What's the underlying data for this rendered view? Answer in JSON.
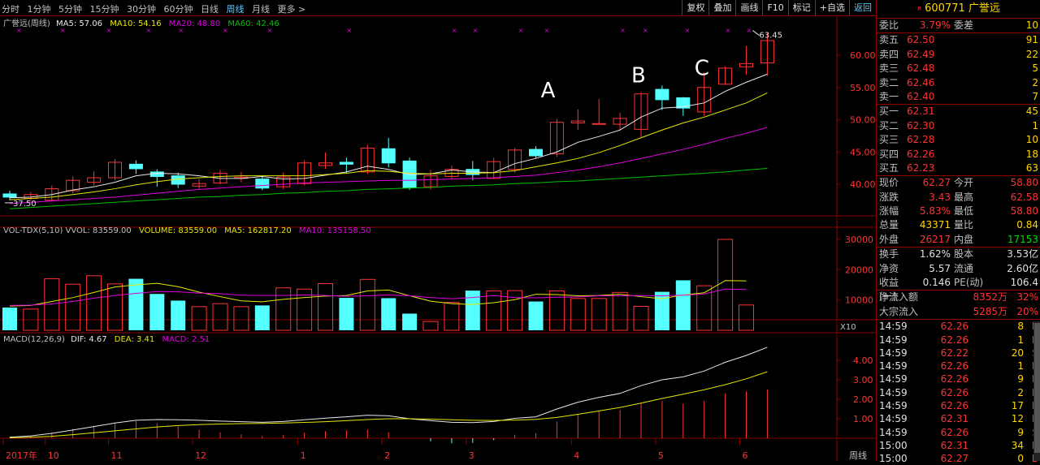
{
  "toolbar": {
    "periods": [
      "分时",
      "1分钟",
      "5分钟",
      "15分钟",
      "30分钟",
      "60分钟",
      "日线",
      "周线",
      "月线",
      "更多 >"
    ],
    "active_period": "周线",
    "buttons": [
      "复权",
      "叠加",
      "画线",
      "F10",
      "标记",
      "+自选",
      "返回"
    ]
  },
  "main_header": {
    "name": "广誉远(周线)",
    "ma5": "MA5: 57.06",
    "ma10": "MA10: 54.16",
    "ma20": "MA20: 48.80",
    "ma60": "MA60: 42.46"
  },
  "vol_header": {
    "name": "VOL-TDX(5,10) VVOL: 83559.00",
    "volume": "VOLUME: 83559.00",
    "ma5": "MA5: 162817.20",
    "ma10": "MA10: 135158.50"
  },
  "macd_header": {
    "name": "MACD(12,26,9)",
    "dif": "DIF: 4.67",
    "dea": "DEA: 3.41",
    "macd": "MACD: 2.51"
  },
  "colors": {
    "up": "#ff3333",
    "down": "#54ffff",
    "ma5": "#e8e8e8",
    "ma10": "#e6e600",
    "ma20": "#e000e0",
    "ma60": "#00c000",
    "grid": "#8b0000"
  },
  "chart_data": {
    "type": "candlestick",
    "price_axis": [
      "60.00",
      "55.00",
      "50.00",
      "45.00",
      "40.00"
    ],
    "vol_axis": [
      "30000",
      "20000",
      "10000"
    ],
    "vol_unit": "X10",
    "macd_axis": [
      "4.00",
      "3.00",
      "2.00",
      "1.00"
    ],
    "x_labels": [
      {
        "i": 0,
        "t": "2017年"
      },
      {
        "i": 2,
        "t": "10"
      },
      {
        "i": 5,
        "t": "11"
      },
      {
        "i": 9,
        "t": "12"
      },
      {
        "i": 14,
        "t": "1"
      },
      {
        "i": 18,
        "t": "2"
      },
      {
        "i": 22,
        "t": "3"
      },
      {
        "i": 27,
        "t": "4"
      },
      {
        "i": 31,
        "t": "5"
      },
      {
        "i": 35,
        "t": "6"
      }
    ],
    "axis_corner": "周线",
    "high_label": "63.45",
    "low_label": "37.50",
    "annotations": [
      {
        "i": 25.7,
        "t": "A"
      },
      {
        "i": 30,
        "t": "B"
      },
      {
        "i": 33,
        "t": "C"
      }
    ],
    "candles": [
      [
        38.5,
        38.0,
        39.0,
        37.5
      ],
      [
        37.8,
        38.4,
        38.8,
        37.4
      ],
      [
        37.5,
        39.3,
        39.8,
        37.3
      ],
      [
        39.0,
        40.6,
        41.2,
        38.6
      ],
      [
        40.3,
        41.0,
        42.0,
        39.8
      ],
      [
        41.0,
        43.4,
        43.9,
        40.6
      ],
      [
        43.1,
        42.4,
        43.7,
        41.6
      ],
      [
        41.9,
        41.2,
        42.3,
        39.6
      ],
      [
        41.3,
        40.0,
        41.8,
        39.4
      ],
      [
        39.7,
        40.1,
        40.8,
        39.3
      ],
      [
        40.2,
        41.7,
        42.2,
        40.0
      ],
      [
        40.9,
        41.1,
        41.9,
        40.3
      ],
      [
        40.8,
        39.4,
        41.2,
        39.1
      ],
      [
        39.6,
        41.1,
        41.8,
        39.2
      ],
      [
        40.1,
        43.3,
        43.7,
        39.8
      ],
      [
        42.9,
        43.3,
        44.9,
        42.4
      ],
      [
        43.4,
        43.1,
        44.1,
        41.7
      ],
      [
        41.9,
        45.6,
        46.1,
        41.6
      ],
      [
        45.5,
        43.3,
        47.2,
        42.6
      ],
      [
        43.6,
        39.5,
        44.1,
        39.1
      ],
      [
        39.6,
        41.3,
        42.2,
        39.2
      ],
      [
        41.2,
        42.3,
        42.9,
        40.7
      ],
      [
        42.3,
        41.5,
        43.6,
        40.6
      ],
      [
        40.9,
        43.5,
        44.1,
        40.8
      ],
      [
        42.3,
        45.3,
        45.6,
        41.8
      ],
      [
        45.4,
        44.4,
        45.9,
        44.0
      ],
      [
        44.7,
        49.6,
        50.1,
        44.2
      ],
      [
        49.5,
        49.8,
        51.6,
        48.4
      ],
      [
        49.4,
        49.4,
        53.2,
        49.4
      ],
      [
        49.3,
        50.2,
        51.1,
        48.4
      ],
      [
        48.5,
        54.0,
        54.3,
        47.3
      ],
      [
        54.7,
        53.1,
        55.3,
        51.5
      ],
      [
        53.4,
        51.8,
        53.5,
        50.6
      ],
      [
        51.2,
        55.0,
        57.3,
        50.6
      ],
      [
        55.5,
        58.0,
        58.3,
        55.4
      ],
      [
        58.2,
        58.7,
        61.4,
        57.0
      ],
      [
        58.8,
        62.27,
        63.45,
        56.8
      ]
    ],
    "volumes": [
      7500,
      7000,
      17000,
      15200,
      18000,
      15300,
      17000,
      12000,
      9800,
      7800,
      8800,
      7800,
      8200,
      14000,
      13600,
      15400,
      10700,
      16800,
      10600,
      5500,
      2900,
      9200,
      13100,
      13000,
      13100,
      9500,
      13000,
      10500,
      10500,
      12500,
      7900,
      12700,
      16500,
      14700,
      30000,
      8356
    ],
    "ma5": [
      37.9,
      38.0,
      38.4,
      39.1,
      39.6,
      40.3,
      41.3,
      41.7,
      41.6,
      41.3,
      40.9,
      40.9,
      41.2,
      40.8,
      40.9,
      41.4,
      41.9,
      42.8,
      42.3,
      41.5,
      41.6,
      42.2,
      41.9,
      41.8,
      43.2,
      44.0,
      45.0,
      46.5,
      47.4,
      48.4,
      50.4,
      51.8,
      52.0,
      52.6,
      54.4,
      55.8,
      57.06
    ],
    "ma10": [
      37.6,
      37.8,
      38.0,
      38.4,
      38.8,
      39.3,
      39.9,
      40.4,
      40.8,
      41.0,
      41.2,
      41.3,
      41.3,
      41.3,
      41.3,
      41.5,
      41.7,
      42.1,
      42.0,
      41.7,
      41.6,
      41.7,
      41.7,
      41.8,
      42.1,
      42.7,
      43.3,
      44.0,
      44.9,
      46.0,
      47.2,
      48.4,
      49.5,
      50.4,
      51.5,
      52.6,
      54.16
    ],
    "ma20": [
      37.0,
      37.2,
      37.4,
      37.6,
      37.8,
      38.0,
      38.3,
      38.6,
      38.9,
      39.2,
      39.4,
      39.6,
      39.8,
      40.0,
      40.2,
      40.3,
      40.4,
      40.5,
      40.6,
      40.6,
      40.7,
      40.8,
      40.9,
      41.0,
      41.2,
      41.4,
      41.8,
      42.2,
      42.7,
      43.3,
      44.0,
      44.7,
      45.4,
      46.2,
      47.1,
      47.9,
      48.8
    ],
    "ma60": [
      36.2,
      36.4,
      36.6,
      36.8,
      37.0,
      37.2,
      37.4,
      37.6,
      37.8,
      38.0,
      38.1,
      38.3,
      38.4,
      38.6,
      38.7,
      38.9,
      39.0,
      39.2,
      39.3,
      39.4,
      39.5,
      39.7,
      39.8,
      39.9,
      40.1,
      40.2,
      40.4,
      40.5,
      40.7,
      40.9,
      41.1,
      41.3,
      41.5,
      41.7,
      41.9,
      42.2,
      42.46
    ],
    "vol_ma5": [
      8000,
      8200,
      9500,
      10800,
      12500,
      14300,
      15000,
      15500,
      14400,
      12600,
      11100,
      9700,
      9400,
      10200,
      10800,
      11300,
      11500,
      13000,
      13300,
      11400,
      9600,
      8800,
      8500,
      9100,
      10100,
      11900,
      11800,
      11400,
      11500,
      11900,
      11100,
      10400,
      11700,
      12400,
      16400,
      16300
    ],
    "vol_ma10": [
      8200,
      8300,
      8700,
      9500,
      10600,
      11500,
      12200,
      12800,
      12700,
      12300,
      12100,
      11600,
      11500,
      11500,
      11700,
      11500,
      11200,
      11400,
      11700,
      11400,
      10800,
      10400,
      10800,
      11500,
      10800,
      10700,
      10900,
      11000,
      11400,
      11400,
      11500,
      11400,
      11600,
      12000,
      13600,
      13500
    ],
    "dif": [
      0.05,
      0.12,
      0.25,
      0.42,
      0.6,
      0.78,
      0.92,
      0.96,
      0.95,
      0.92,
      0.88,
      0.85,
      0.82,
      0.86,
      0.95,
      1.03,
      1.1,
      1.18,
      1.15,
      1.0,
      0.9,
      0.82,
      0.8,
      0.86,
      1.02,
      1.1,
      1.5,
      1.85,
      2.1,
      2.3,
      2.7,
      3.0,
      3.15,
      3.45,
      3.9,
      4.25,
      4.67
    ],
    "dea": [
      0.02,
      0.05,
      0.1,
      0.18,
      0.28,
      0.38,
      0.48,
      0.58,
      0.65,
      0.7,
      0.73,
      0.75,
      0.76,
      0.78,
      0.81,
      0.85,
      0.9,
      0.96,
      1.0,
      1.0,
      0.98,
      0.95,
      0.92,
      0.91,
      0.93,
      0.97,
      1.07,
      1.23,
      1.4,
      1.58,
      1.8,
      2.04,
      2.26,
      2.49,
      2.75,
      3.05,
      3.41
    ],
    "macd": [
      0.06,
      0.14,
      0.3,
      0.48,
      0.64,
      0.8,
      0.88,
      0.76,
      0.6,
      0.44,
      0.3,
      0.2,
      0.12,
      0.16,
      0.28,
      0.36,
      0.4,
      0.44,
      0.3,
      0.0,
      -0.16,
      -0.26,
      -0.24,
      -0.1,
      0.18,
      0.26,
      0.86,
      1.24,
      1.4,
      1.44,
      1.8,
      1.92,
      1.78,
      1.92,
      2.3,
      2.4,
      2.51
    ]
  },
  "right_panel": {
    "code": "600771",
    "code_sup": "R",
    "name": "广誉远",
    "webi": {
      "label": "委比",
      "value": "3.79%",
      "label2": "委差",
      "value2": "10"
    },
    "asks": [
      {
        "l": "卖五",
        "p": "62.50",
        "v": "91"
      },
      {
        "l": "卖四",
        "p": "62.49",
        "v": "22"
      },
      {
        "l": "卖三",
        "p": "62.48",
        "v": "5"
      },
      {
        "l": "卖二",
        "p": "62.46",
        "v": "2"
      },
      {
        "l": "卖一",
        "p": "62.40",
        "v": "7"
      }
    ],
    "bids": [
      {
        "l": "买一",
        "p": "62.31",
        "v": "45"
      },
      {
        "l": "买二",
        "p": "62.30",
        "v": "1"
      },
      {
        "l": "买三",
        "p": "62.28",
        "v": "10"
      },
      {
        "l": "买四",
        "p": "62.26",
        "v": "18"
      },
      {
        "l": "买五",
        "p": "62.23",
        "v": "63"
      }
    ],
    "quote": [
      {
        "a": "现价",
        "b": "62.27",
        "bc": "red",
        "c": "今开",
        "d": "58.80",
        "dc": "red"
      },
      {
        "a": "涨跌",
        "b": "3.43",
        "bc": "red",
        "c": "最高",
        "d": "62.58",
        "dc": "red"
      },
      {
        "a": "涨幅",
        "b": "5.83%",
        "bc": "red",
        "c": "最低",
        "d": "58.80",
        "dc": "red"
      },
      {
        "a": "总量",
        "b": "43371",
        "bc": "yel",
        "c": "量比",
        "d": "0.84",
        "dc": "yel"
      },
      {
        "a": "外盘",
        "b": "26217",
        "bc": "red",
        "c": "内盘",
        "d": "17153",
        "dc": "green"
      }
    ],
    "fund": [
      {
        "a": "换手",
        "b": "1.62%",
        "c": "股本",
        "d": "3.53亿"
      },
      {
        "a": "净资",
        "b": "5.57",
        "c": "流通",
        "d": "2.60亿"
      },
      {
        "a": "收益(一)",
        "b": "0.146",
        "c": "PE(动)",
        "d": "106.4"
      }
    ],
    "flow": [
      {
        "a": "净流入额",
        "b": "8352万",
        "c": "32%"
      },
      {
        "a": "大宗流入",
        "b": "5285万",
        "c": "20%"
      }
    ],
    "ticks": [
      {
        "t": "14:59",
        "p": "62.26",
        "v": "8",
        "f": "B"
      },
      {
        "t": "14:59",
        "p": "62.26",
        "v": "1",
        "f": "B"
      },
      {
        "t": "14:59",
        "p": "62.22",
        "v": "20",
        "f": "S"
      },
      {
        "t": "14:59",
        "p": "62.26",
        "v": "1",
        "f": "B"
      },
      {
        "t": "14:59",
        "p": "62.26",
        "v": "9",
        "f": "B"
      },
      {
        "t": "14:59",
        "p": "62.26",
        "v": "2",
        "f": "B"
      },
      {
        "t": "14:59",
        "p": "62.26",
        "v": "17",
        "f": "B"
      },
      {
        "t": "14:59",
        "p": "62.31",
        "v": "12",
        "f": "B"
      },
      {
        "t": "14:59",
        "p": "62.26",
        "v": "9",
        "f": "S"
      },
      {
        "t": "15:00",
        "p": "62.31",
        "v": "34",
        "f": "B"
      },
      {
        "t": "15:00",
        "p": "62.27",
        "v": "0",
        "f": "B"
      }
    ]
  }
}
